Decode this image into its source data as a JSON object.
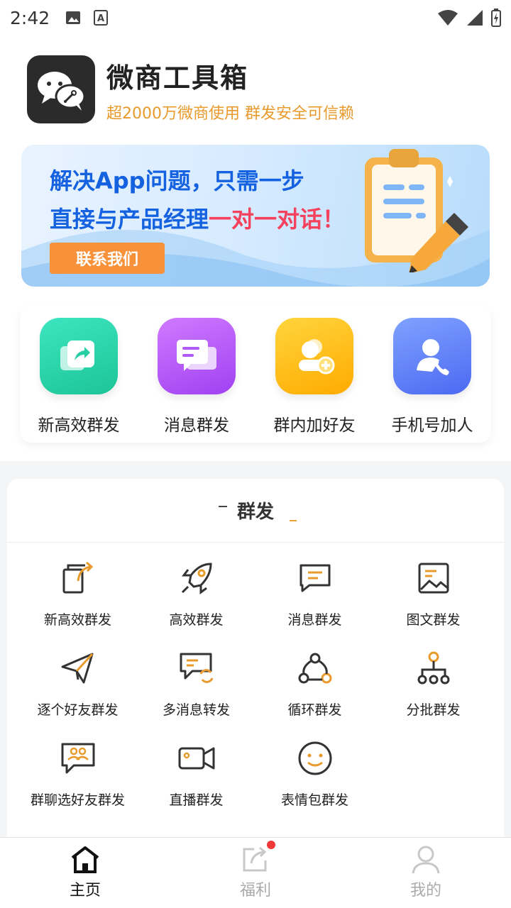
{
  "status": {
    "time": "2:42"
  },
  "header": {
    "title": "微商工具箱",
    "subtitle": "超2000万微商使用  群发安全可信赖"
  },
  "banner": {
    "line1": "解决App问题，只需一步",
    "line2_prefix": "直接与产品经理",
    "line2_highlight": "一对一对话！",
    "button": "联系我们"
  },
  "quick_actions": [
    {
      "label": "新高效群发",
      "icon": "share-square-icon",
      "color_from": "#34e0b6",
      "color_to": "#1fc59a"
    },
    {
      "label": "消息群发",
      "icon": "message-icon",
      "color_from": "#c266ff",
      "color_to": "#a040f0"
    },
    {
      "label": "群内加好友",
      "icon": "group-add-icon",
      "color_from": "#ffcf33",
      "color_to": "#ffae00"
    },
    {
      "label": "手机号加人",
      "icon": "phone-contact-icon",
      "color_from": "#7a9cff",
      "color_to": "#4e6cf5"
    }
  ],
  "section": {
    "title": "群发",
    "items": [
      {
        "label": "新高效群发",
        "icon": "copy-share-icon"
      },
      {
        "label": "高效群发",
        "icon": "rocket-icon"
      },
      {
        "label": "消息群发",
        "icon": "chat-bubble-icon"
      },
      {
        "label": "图文群发",
        "icon": "image-icon"
      },
      {
        "label": "逐个好友群发",
        "icon": "paper-plane-icon"
      },
      {
        "label": "多消息转发",
        "icon": "chat-refresh-icon"
      },
      {
        "label": "循环群发",
        "icon": "cycle-icon"
      },
      {
        "label": "分批群发",
        "icon": "hierarchy-icon"
      },
      {
        "label": "群聊选好友群发",
        "icon": "group-chat-icon"
      },
      {
        "label": "直播群发",
        "icon": "video-camera-icon"
      },
      {
        "label": "表情包群发",
        "icon": "smile-icon"
      }
    ]
  },
  "tabs": [
    {
      "label": "主页",
      "icon": "home-icon",
      "active": true
    },
    {
      "label": "福利",
      "icon": "share-icon",
      "active": false
    },
    {
      "label": "我的",
      "icon": "user-icon",
      "active": false
    }
  ],
  "colors": {
    "accent": "#e99a2d",
    "primary_blue": "#1562e0",
    "highlight_red": "#f5415b"
  }
}
